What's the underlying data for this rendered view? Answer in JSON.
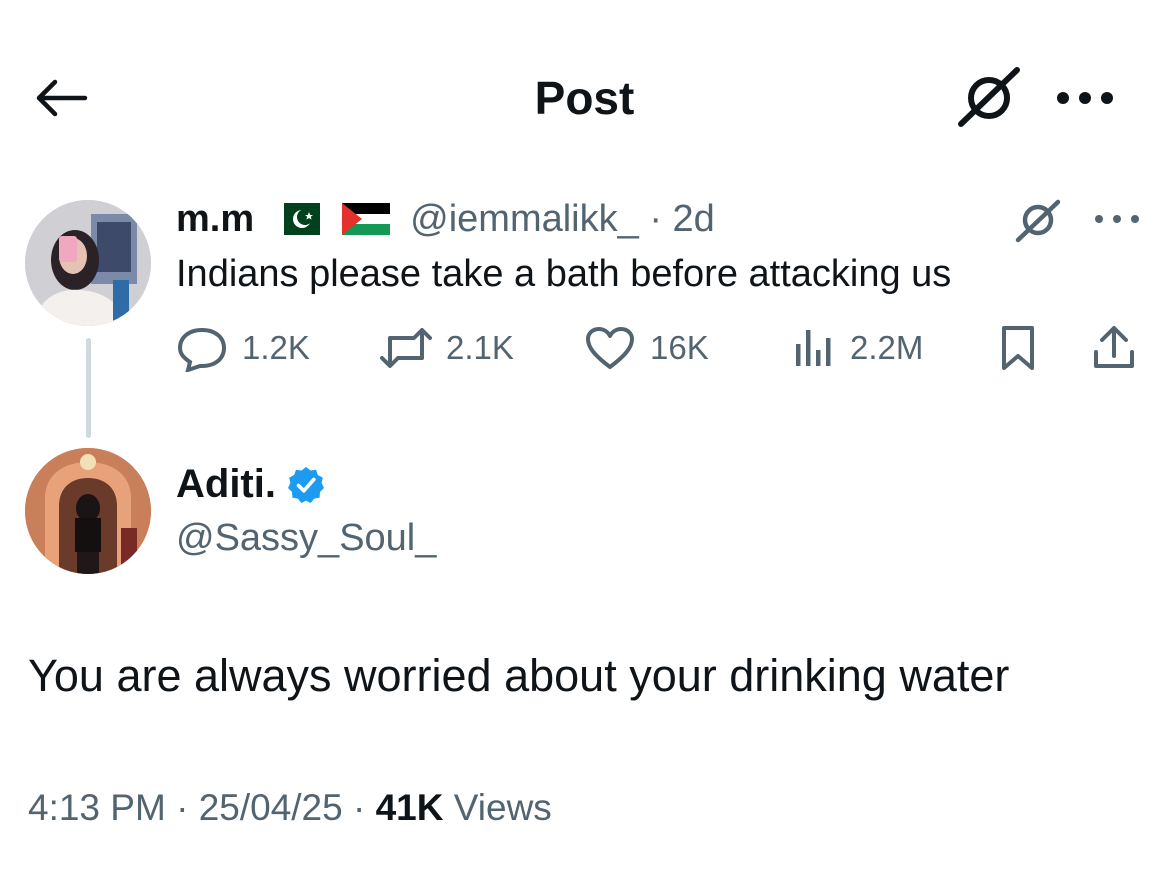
{
  "header": {
    "title": "Post",
    "back_icon": "arrow-left-icon",
    "grok_icon": "grok-icon",
    "more_icon": "more-horizontal-icon"
  },
  "parent_post": {
    "display_name": "m.m",
    "flags": [
      "pakistan-flag",
      "palestine-flag"
    ],
    "handle": "@iemmalikk_",
    "age": "2d",
    "text": "Indians please take a bath before attacking us",
    "replies": "1.2K",
    "reposts": "2.1K",
    "likes": "16K",
    "views": "2.2M",
    "icons": {
      "reply": "reply-icon",
      "repost": "repost-icon",
      "like": "heart-icon",
      "views": "views-chart-icon",
      "bookmark": "bookmark-icon",
      "share": "share-icon"
    }
  },
  "main_post": {
    "display_name": "Aditi.",
    "verified": true,
    "handle": "@Sassy_Soul_",
    "text": "You are always worried about your drinking water",
    "time": "4:13 PM",
    "date": "25/04/25",
    "views_count": "41K",
    "views_label": "Views"
  },
  "colors": {
    "text": "#0f1419",
    "secondary": "#536471",
    "verified_blue": "#1d9bf0",
    "thread_line": "#cfd9de"
  }
}
